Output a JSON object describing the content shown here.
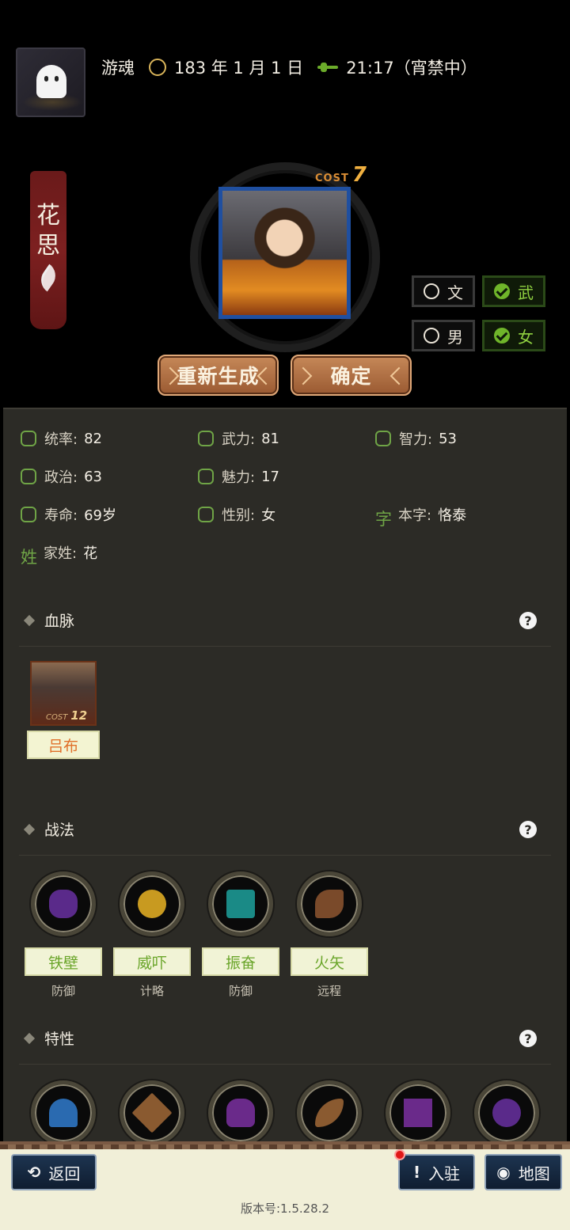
{
  "header": {
    "player_name": "游魂",
    "date": "183 年 1 月 1 日",
    "time": "21:17（宵禁中）"
  },
  "character": {
    "name_chars": [
      "花",
      "思"
    ],
    "cost_label": "COST",
    "cost_value": "7"
  },
  "toggles": {
    "wen": {
      "label": "文",
      "selected": false
    },
    "wu": {
      "label": "武",
      "selected": true
    },
    "male": {
      "label": "男",
      "selected": false
    },
    "female": {
      "label": "女",
      "selected": true
    }
  },
  "actions": {
    "regenerate": "重新生成",
    "confirm": "确定"
  },
  "stats": [
    {
      "label": "统率:",
      "value": "82",
      "icon": "flag-icon"
    },
    {
      "label": "武力:",
      "value": "81",
      "icon": "arm-icon"
    },
    {
      "label": "智力:",
      "value": "53",
      "icon": "brain-icon"
    },
    {
      "label": "政治:",
      "value": "63",
      "icon": "crown-icon"
    },
    {
      "label": "魅力:",
      "value": "17",
      "icon": "eye-icon"
    },
    {
      "label": "寿命:",
      "value": "69岁",
      "icon": "longevity-icon"
    },
    {
      "label": "性别:",
      "value": "女",
      "icon": "gender-icon"
    },
    {
      "label": "本字:",
      "value": "恪泰",
      "icon_glyph": "字"
    },
    {
      "label": "家姓:",
      "value": "花",
      "icon_glyph": "姓"
    }
  ],
  "bloodline": {
    "title": "血脉",
    "card": {
      "name": "吕布",
      "cost_label": "COST",
      "cost_value": "12"
    }
  },
  "tactics": {
    "title": "战法",
    "items": [
      {
        "name": "铁壁",
        "type": "防御",
        "color": "#5a2a8a"
      },
      {
        "name": "威吓",
        "type": "计略",
        "color": "#c89a20"
      },
      {
        "name": "振奋",
        "type": "防御",
        "color": "#1a8a86"
      },
      {
        "name": "火矢",
        "type": "远程",
        "color": "#7a4a2a"
      }
    ]
  },
  "traits": {
    "title": "特性",
    "items": [
      {
        "icon": "hand-water-icon",
        "color": "#2a6ab0"
      },
      {
        "icon": "burst-icon",
        "color": "#8a5a30"
      },
      {
        "icon": "demon-icon",
        "color": "#6a2a8a"
      },
      {
        "icon": "claw-icon",
        "color": "#8a5a30"
      },
      {
        "icon": "gate-icon",
        "color": "#6a2a8a"
      },
      {
        "icon": "mask-icon",
        "color": "#5a2a8a"
      }
    ]
  },
  "help_glyph": "?",
  "bottom": {
    "back": "返回",
    "back_glyph": "⟲",
    "station": "入驻",
    "station_glyph": "!",
    "map": "地图",
    "map_glyph": "◉",
    "version": "版本号:1.5.28.2"
  }
}
